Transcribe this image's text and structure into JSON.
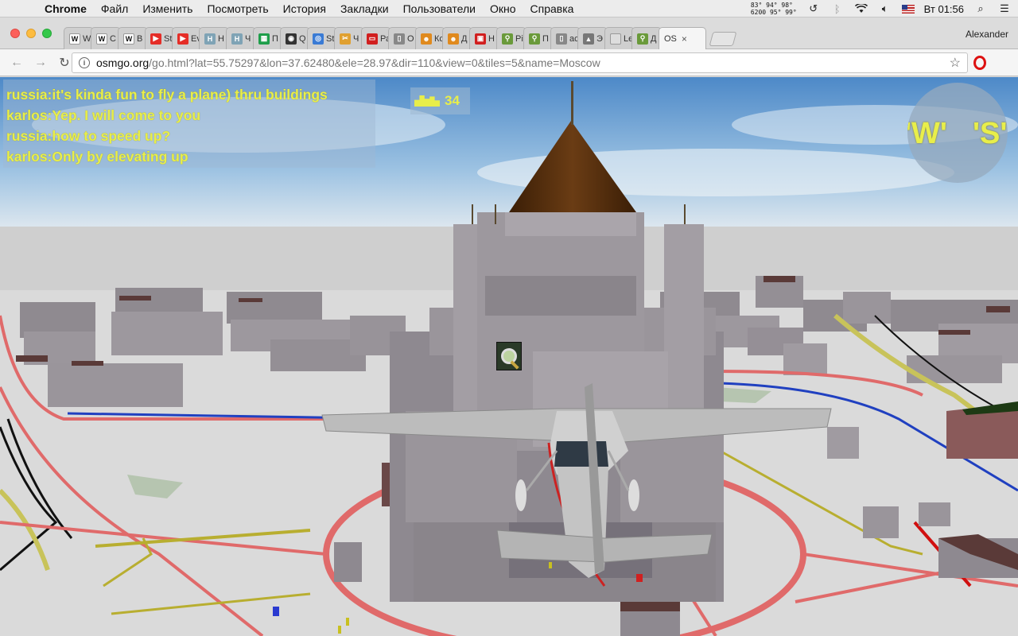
{
  "menubar": {
    "app_name": "Chrome",
    "items": [
      "Файл",
      "Изменить",
      "Посмотреть",
      "История",
      "Закладки",
      "Пользователи",
      "Окно",
      "Справка"
    ],
    "stats_line1": "83° 94° 98°",
    "stats_line2": "6200 95° 99°",
    "clock": "Вт 01:56"
  },
  "tabs": [
    {
      "label": "W",
      "fav": "W",
      "color": "#ffffff"
    },
    {
      "label": "C",
      "fav": "W",
      "color": "#ffffff"
    },
    {
      "label": "B",
      "fav": "W",
      "color": "#ffffff"
    },
    {
      "label": "St",
      "fav": "▶",
      "color": "#e52d27"
    },
    {
      "label": "Ev",
      "fav": "▶",
      "color": "#e52d27"
    },
    {
      "label": "Н",
      "fav": "H",
      "color": "#7fa3b5"
    },
    {
      "label": "Ч",
      "fav": "H",
      "color": "#7fa3b5"
    },
    {
      "label": "П",
      "fav": "▦",
      "color": "#1e9e4a"
    },
    {
      "label": "Q",
      "fav": "◉",
      "color": "#333333"
    },
    {
      "label": "St",
      "fav": "◎",
      "color": "#3a7bd5"
    },
    {
      "label": "Ч",
      "fav": "✂",
      "color": "#e0a030"
    },
    {
      "label": "Ра",
      "fav": "▭",
      "color": "#d11f1f"
    },
    {
      "label": "О",
      "fav": "▯",
      "color": "#888888"
    },
    {
      "label": "Кс",
      "fav": "☻",
      "color": "#e08a1e"
    },
    {
      "label": "Д",
      "fav": "☻",
      "color": "#e08a1e"
    },
    {
      "label": "Н",
      "fav": "▣",
      "color": "#d11f1f"
    },
    {
      "label": "Рі",
      "fav": "⚲",
      "color": "#6a9a3a"
    },
    {
      "label": "П",
      "fav": "⚲",
      "color": "#6a9a3a"
    },
    {
      "label": "ас",
      "fav": "▯",
      "color": "#888888"
    },
    {
      "label": "Э",
      "fav": "▲",
      "color": "#777777"
    },
    {
      "label": "Le",
      "fav": "",
      "color": "#dddddd"
    },
    {
      "label": "Д",
      "fav": "⚲",
      "color": "#6a9a3a"
    }
  ],
  "active_tab": {
    "label": "OS",
    "close": "×"
  },
  "profile_name": "Alexander",
  "address": {
    "host": "osmgo.org",
    "path": "/go.html?lat=55.75297&lon=37.62480&ele=28.97&dir=110&view=0&tiles=5&name=Moscow"
  },
  "game": {
    "chat": [
      "russia:it's kinda fun to fly a plane) thru buildings",
      "karlos:Yep. I will come to you",
      "russia:how to speed up?",
      "karlos:Only by elevating up"
    ],
    "building_count": "34",
    "compass_left": "'W'",
    "compass_right": "'S'",
    "colors": {
      "hud_text": "#e8ee4a",
      "building": "#8f8a90",
      "dome": "#5a3210",
      "road": "#e06060",
      "ground": "#dcdcdc"
    }
  }
}
